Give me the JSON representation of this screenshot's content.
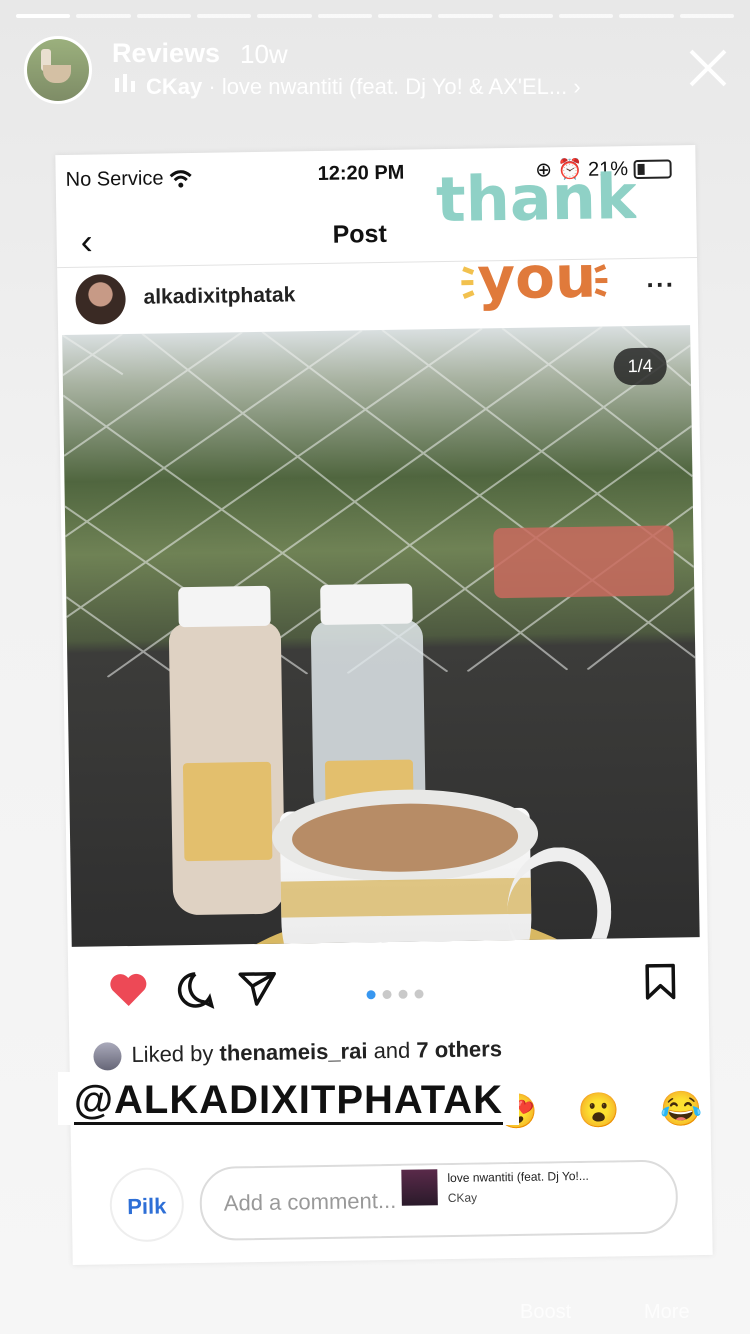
{
  "story": {
    "title": "Reviews",
    "time": "10w",
    "music": {
      "artist": "CKay",
      "track": "love nwantiti (feat. Dj Yo! & AX'EL..."
    },
    "segments": 12
  },
  "screenshot": {
    "status": {
      "carrier": "No Service",
      "time": "12:20 PM",
      "battery": "21%"
    },
    "nav": {
      "title": "Post"
    },
    "author": "alkadixitphatak",
    "counter": "1/4",
    "likes": {
      "prefix": "Liked by ",
      "user": "thenameis_rai",
      "mid": " and ",
      "others": "7 others"
    },
    "comment_placeholder": "Add a comment...",
    "brand": "Pilk",
    "music_sticker": {
      "title": "love nwantiti (feat. Dj Yo!...",
      "artist": "CKay"
    }
  },
  "sticker": {
    "line1": "thank",
    "line2": "you"
  },
  "mention": "@ALKADIXITPHATAK",
  "reactions": [
    "😍",
    "😮",
    "😂"
  ],
  "bottom": {
    "left": "Boost",
    "right": "More"
  },
  "colors": {
    "like": "#ed4956",
    "accent": "#3897f0"
  }
}
